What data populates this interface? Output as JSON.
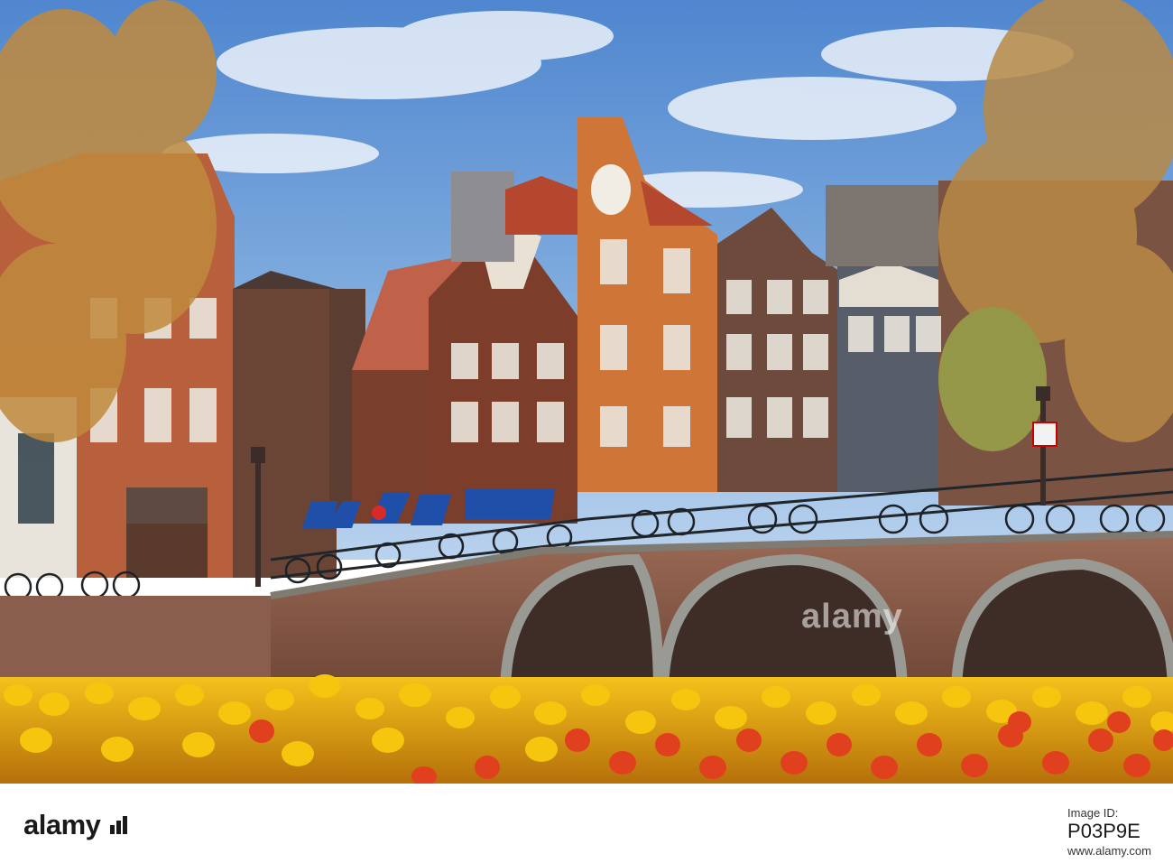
{
  "photo": {
    "subject": "canal-houses-bridge-tulips"
  },
  "watermark": {
    "logo_text": "alamy"
  },
  "footer": {
    "logo_text": "alamy",
    "image_id_label": "Image ID:",
    "image_id": "P03P9E",
    "site": "www.alamy.com"
  },
  "colors": {
    "sky": "#6f9fd6",
    "brick": "#8a4a35",
    "orange_facade": "#d4753a",
    "tulip_yellow": "#f2b705",
    "tulip_red": "#e0401e",
    "awning_blue": "#1f4fa8"
  }
}
